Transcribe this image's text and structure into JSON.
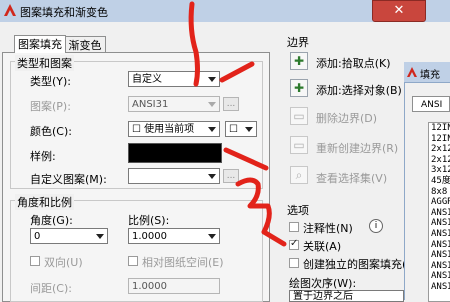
{
  "window": {
    "title": "图案填充和渐变色",
    "close_glyph": "✕"
  },
  "tabs": [
    {
      "label": "图案填充",
      "active": true
    },
    {
      "label": "渐变色",
      "active": false
    }
  ],
  "type_group": {
    "title": "类型和图案",
    "type_label": "类型(Y):",
    "type_value": "自定义",
    "pattern_label": "图案(P):",
    "pattern_value": "ANSI31",
    "color_label": "颜色(C):",
    "color_value": "☐ 使用当前项",
    "color_value2": "☐",
    "swatch_label": "样例:",
    "custom_label": "自定义图案(M):",
    "custom_value": "",
    "ellipsis": "..."
  },
  "angle_group": {
    "title": "角度和比例",
    "angle_label": "角度(G):",
    "angle_value": "0",
    "scale_label": "比例(S):",
    "scale_value": "1.0000",
    "double_label": "双向(U)",
    "relative_label": "相对图纸空间(E)",
    "spacing_label": "间距(C):",
    "spacing_value": "1.0000"
  },
  "boundary": {
    "title": "边界",
    "add_pick": "添加:拾取点(K)",
    "add_select": "添加:选择对象(B)",
    "remove": "删除边界(D)",
    "recreate": "重新创建边界(R)",
    "view": "查看选择集(V)"
  },
  "options": {
    "title": "选项",
    "annotative": "注释性(N)",
    "associative": "关联(A)",
    "independent": "创建独立的图案填充(H)",
    "draw_order_label": "绘图次序(W):",
    "draw_order_value": "置于边界之后"
  },
  "palette": {
    "title": "填充",
    "tab_label": "ANSI",
    "items": [
      "12IN",
      "12IN",
      "2x12",
      "2x12",
      "3x12",
      "45度",
      "8x8",
      "AGGR",
      "ANSI",
      "ANSI",
      "ANSI",
      "ANSI",
      "ANSI",
      "ANSI",
      "ANSI",
      "ANSI"
    ]
  },
  "annotations": {
    "mark_1": "1",
    "mark_2": "2"
  },
  "colors": {
    "red": "#e2231a",
    "title_bg": "#bfd0e6",
    "close": "#c9463d"
  }
}
